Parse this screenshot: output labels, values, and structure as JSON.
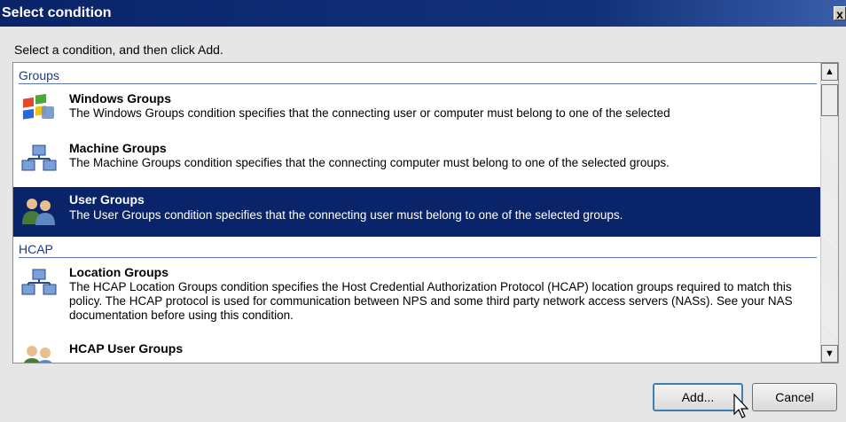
{
  "dialog": {
    "title": "Select condition",
    "close_glyph": "x"
  },
  "instruction": "Select a condition, and then click Add.",
  "groups": [
    {
      "label": "Groups"
    },
    {
      "label": "HCAP"
    }
  ],
  "items": [
    {
      "title": "Windows Groups",
      "description": "The Windows Groups condition specifies that the connecting user or computer must belong to one of the selected",
      "icon": "windows-groups-icon",
      "selected": false
    },
    {
      "title": "Machine Groups",
      "description": "The Machine Groups condition specifies that the connecting computer must belong to one of the selected groups.",
      "icon": "machine-groups-icon",
      "selected": false
    },
    {
      "title": "User Groups",
      "description": "The User Groups condition specifies that the connecting user must belong to one of the selected groups.",
      "icon": "user-groups-icon",
      "selected": true
    },
    {
      "title": "Location Groups",
      "description": "The HCAP Location Groups condition specifies the Host Credential Authorization Protocol (HCAP) location groups required to match this policy. The HCAP protocol is used for communication between NPS and some third party network access servers (NASs). See your NAS documentation before using this condition.",
      "icon": "location-groups-icon",
      "selected": false
    },
    {
      "title": "HCAP User Groups",
      "description": "",
      "icon": "hcap-user-groups-icon",
      "selected": false
    }
  ],
  "buttons": {
    "add": "Add...",
    "cancel": "Cancel"
  },
  "colors": {
    "selection": "#0a246a",
    "titlebar": "#0a246a",
    "group_header_text": "#1c3a8c"
  }
}
